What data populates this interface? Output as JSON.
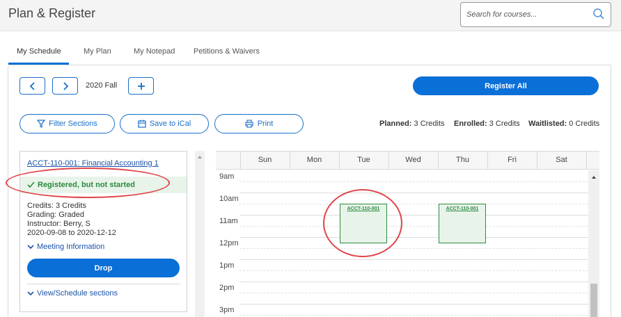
{
  "header": {
    "title": "Plan & Register",
    "search_placeholder": "Search for courses...",
    "search_icon": "search-icon"
  },
  "tabs": [
    {
      "label": "My Schedule",
      "active": true
    },
    {
      "label": "My Plan",
      "active": false
    },
    {
      "label": "My Notepad",
      "active": false
    },
    {
      "label": "Petitions & Waivers",
      "active": false
    }
  ],
  "toolbar": {
    "term": "2020 Fall",
    "register_all": "Register All",
    "filter_sections": "Filter Sections",
    "save_to_ical": "Save to iCal",
    "print": "Print"
  },
  "summary": {
    "planned_label": "Planned:",
    "planned_value": "3 Credits",
    "enrolled_label": "Enrolled:",
    "enrolled_value": "3 Credits",
    "waitlisted_label": "Waitlisted:",
    "waitlisted_value": "0 Credits"
  },
  "course_card": {
    "title": "ACCT-110-001: Financial Accounting 1",
    "status": "Registered, but not started",
    "credits": "Credits: 3 Credits",
    "grading": "Grading: Graded",
    "instructor": "Instructor: Berry, S",
    "dates": "2020-09-08 to 2020-12-12",
    "meeting_info": "Meeting Information",
    "drop": "Drop",
    "view_schedule": "View/Schedule sections"
  },
  "calendar": {
    "days": [
      "Sun",
      "Mon",
      "Tue",
      "Wed",
      "Thu",
      "Fri",
      "Sat"
    ],
    "hours": [
      "9am",
      "10am",
      "11am",
      "12pm",
      "1pm",
      "2pm",
      "3pm"
    ],
    "events": [
      {
        "label": "ACCT-110-001",
        "day": "Tue"
      },
      {
        "label": "ACCT-110-001",
        "day": "Thu"
      }
    ]
  },
  "colors": {
    "accent": "#0a6fd6",
    "success": "#2b8a3e",
    "success_bg": "#e8f4ea",
    "annotation": "#e0454a"
  }
}
